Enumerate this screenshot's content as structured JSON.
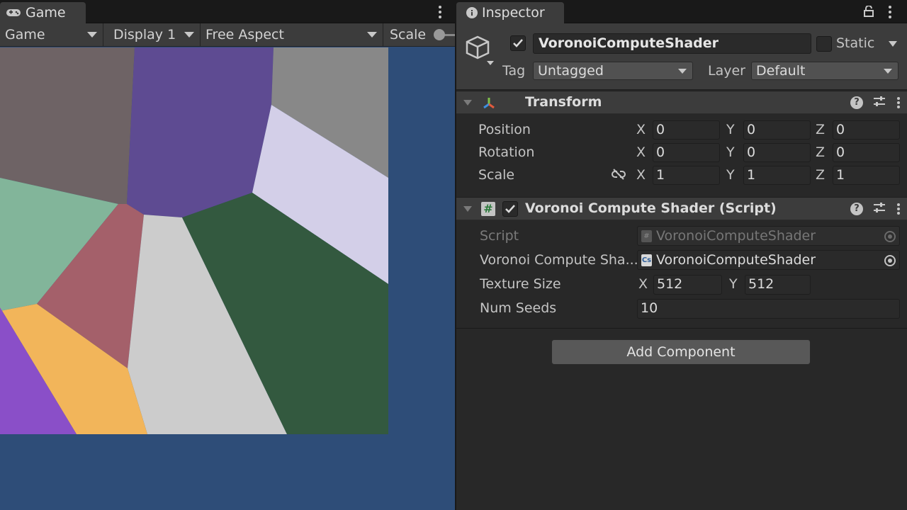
{
  "game": {
    "tab_label": "Game",
    "toolbar": {
      "mode": "Game",
      "display": "Display 1",
      "aspect": "Free Aspect",
      "scale_label": "Scale"
    },
    "background_color": "#2e4d78",
    "voronoi_cell_colors": [
      "#6e6365",
      "#5e4b92",
      "#888888",
      "#d3cfe8",
      "#82b59a",
      "#a4606a",
      "#cccccc",
      "#33593f",
      "#f2b55a",
      "#8a4fc8"
    ]
  },
  "inspector": {
    "tab_label": "Inspector",
    "object": {
      "active": true,
      "name": "VoronoiComputeShader",
      "static_label": "Static",
      "static_checked": false,
      "tag_label": "Tag",
      "tag_value": "Untagged",
      "layer_label": "Layer",
      "layer_value": "Default"
    },
    "transform": {
      "title": "Transform",
      "rows": [
        {
          "label": "Position",
          "x": "0",
          "y": "0",
          "z": "0"
        },
        {
          "label": "Rotation",
          "x": "0",
          "y": "0",
          "z": "0"
        },
        {
          "label": "Scale",
          "x": "1",
          "y": "1",
          "z": "1"
        }
      ],
      "axes": {
        "x": "X",
        "y": "Y",
        "z": "Z"
      }
    },
    "script_component": {
      "enabled": true,
      "title": "Voronoi Compute Shader (Script)",
      "script_label": "Script",
      "script_value": "VoronoiComputeShader",
      "shader_label": "Voronoi Compute Sha...",
      "shader_value": "VoronoiComputeShader",
      "shader_icon_text": "Cs",
      "texture_label": "Texture Size",
      "texture_x": "512",
      "texture_y": "512",
      "seeds_label": "Num Seeds",
      "seeds_value": "10"
    },
    "add_component_label": "Add Component"
  }
}
